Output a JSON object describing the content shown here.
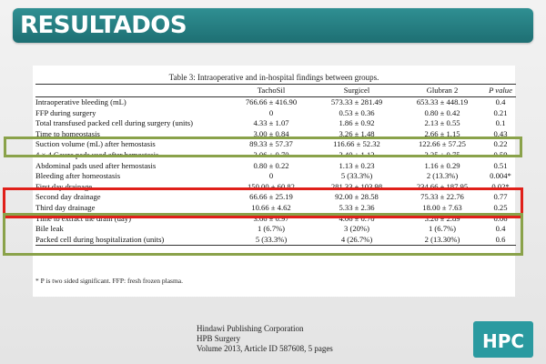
{
  "title": "RESULTADOS",
  "table": {
    "caption": "Table 3: Intraoperative and in-hospital findings between groups.",
    "columns": [
      "",
      "TachoSil",
      "Surgicel",
      "Glubran 2",
      "P value"
    ],
    "rows": [
      [
        "Intraoperative bleeding (mL)",
        "766.66 ± 416.90",
        "573.33 ± 281.49",
        "653.33 ± 448.19",
        "0.4"
      ],
      [
        "FFP during surgery",
        "0",
        "0.53 ± 0.36",
        "0.80 ± 0.42",
        "0.21"
      ],
      [
        "Total transfused packed cell during surgery (units)",
        "4.33 ± 1.07",
        "1.86 ± 0.92",
        "2.13 ± 0.55",
        "0.1"
      ],
      [
        "Time to homeostasis",
        "3.00 ± 0.84",
        "3.26 ± 1.48",
        "2.66 ± 1.15",
        "0.43"
      ],
      [
        "Suction volume (mL) after hemostasis",
        "89.33 ± 57.37",
        "116.66 ± 52.32",
        "122.66 ± 57.25",
        "0.22"
      ],
      [
        "4 × 4 Gauze pads used after hemostasis",
        "3.06 ± 0.70",
        "3.40 ± 1.12",
        "3.25 ± 0.75",
        "0.59"
      ],
      [
        "Abdominal pads used after hemostasis",
        "0.80 ± 0.22",
        "1.13 ± 0.23",
        "1.16 ± 0.29",
        "0.51"
      ],
      [
        "Bleeding after homeostasis",
        "0",
        "5 (33.3%)",
        "2 (13.3%)",
        "0.004*"
      ],
      [
        "First day drainage",
        "150.00 ± 60.82",
        "281.33 ± 103.98",
        "234.66 ± 187.95",
        "0.02*"
      ],
      [
        "Second day drainage",
        "66.66 ± 25.19",
        "92.00 ± 28.58",
        "75.33 ± 22.76",
        "0.77"
      ],
      [
        "Third day drainage",
        "10.66 ± 4.62",
        "5.33 ± 2.36",
        "18.00 ± 7.63",
        "0.25"
      ],
      [
        "Time to extract the drain (day)",
        "3.66 ± 0.97",
        "4.06 ± 0.70",
        "5.26 ± 2.89",
        "0.06"
      ],
      [
        "Bile leak",
        "1 (6.7%)",
        "3 (20%)",
        "1 (6.7%)",
        "0.4"
      ],
      [
        "Packed cell during hospitalization (units)",
        "5 (33.3%)",
        "4 (26.7%)",
        "2 (13.30%)",
        "0.6"
      ]
    ],
    "footnote": "* P is two sided significant. FFP: fresh frozen plasma."
  },
  "source": {
    "line1": "Hindawi Publishing Corporation",
    "line2": "HPB Surgery",
    "line3": "Volume 2013, Article ID 587608, 5 pages"
  },
  "logo": {
    "text": "HPC"
  },
  "colors": {
    "title_bar": "#1e6f73",
    "highlight_green": "#8aa24a",
    "highlight_red": "#e0201a",
    "logo": "#2a9aa0"
  }
}
